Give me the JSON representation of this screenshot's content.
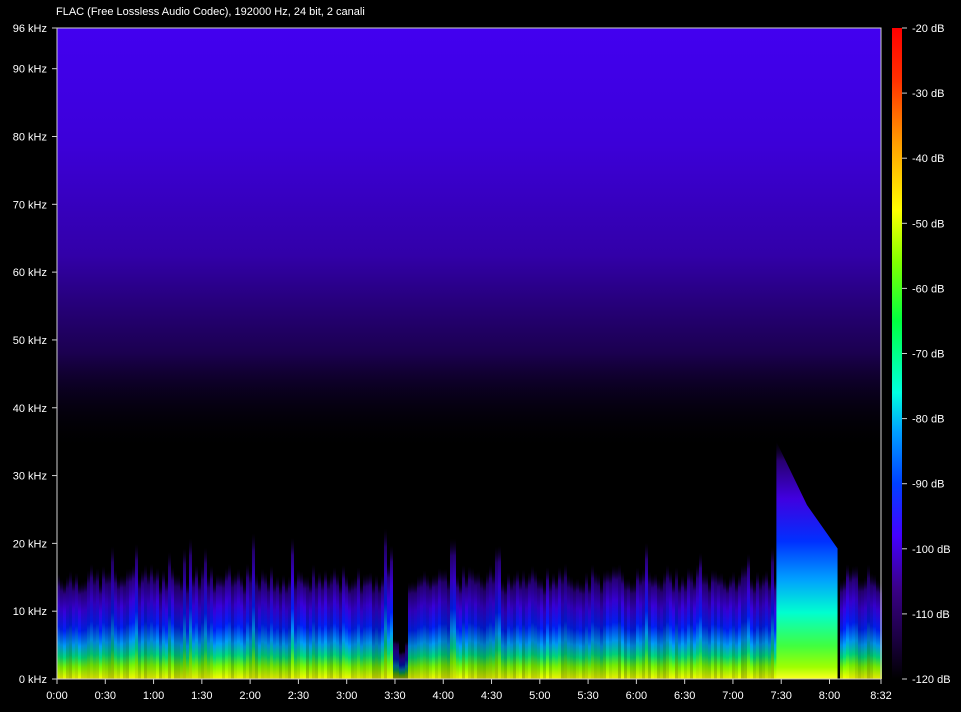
{
  "chart_data": {
    "type": "heatmap",
    "title": "FLAC (Free Lossless Audio Codec), 192000 Hz, 24 bit, 2 canali",
    "x_axis": {
      "ticks": [
        "0:00",
        "0:30",
        "1:00",
        "1:30",
        "2:00",
        "2:30",
        "3:00",
        "3:30",
        "4:00",
        "4:30",
        "5:00",
        "5:30",
        "6:00",
        "6:30",
        "7:00",
        "7:30",
        "8:00",
        "8:32"
      ],
      "range_seconds": [
        0,
        512
      ]
    },
    "y_axis": {
      "ticks": [
        "0 kHz",
        "10 kHz",
        "20 kHz",
        "30 kHz",
        "40 kHz",
        "50 kHz",
        "60 kHz",
        "70 kHz",
        "80 kHz",
        "90 kHz",
        "96 kHz"
      ],
      "range_khz": [
        0,
        96
      ]
    },
    "colorbar": {
      "ticks": [
        "-20 dB",
        "-30 dB",
        "-40 dB",
        "-50 dB",
        "-60 dB",
        "-70 dB",
        "-80 dB",
        "-90 dB",
        "-100 dB",
        "-110 dB",
        "-120 dB"
      ],
      "range_db": [
        -120,
        -20
      ],
      "colors": [
        "#000000",
        "#1a0040",
        "#3a0088",
        "#4400ff",
        "#0040ff",
        "#00a0ff",
        "#00ffe0",
        "#00ff40",
        "#80ff00",
        "#ffff00",
        "#ffa000",
        "#ff3000",
        "#ff0000"
      ]
    },
    "features": {
      "music_bandwidth_khz": 16,
      "noise_floor_top_khz": 96,
      "silent_gap_seconds": [
        212
      ],
      "tail_section_seconds": [
        447,
        485
      ],
      "tail_section_max_khz": 35
    }
  }
}
